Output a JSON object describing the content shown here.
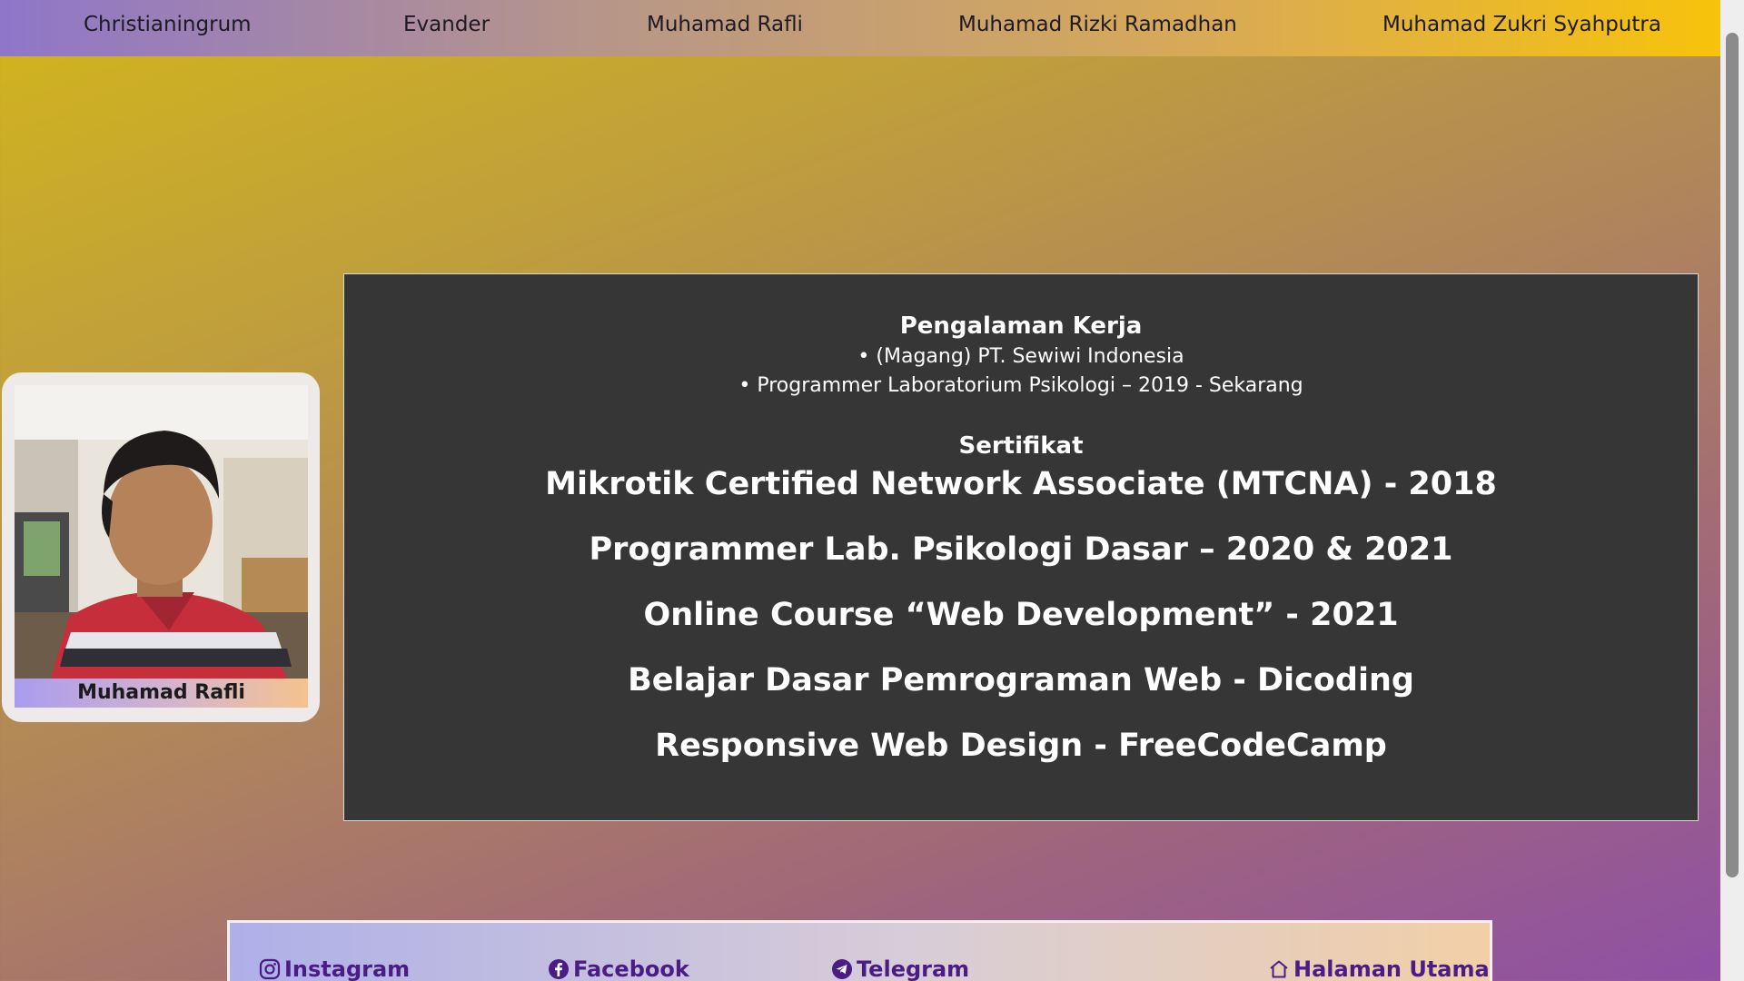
{
  "nav": {
    "items": [
      {
        "label": "Christianingrum"
      },
      {
        "label": "Evander"
      },
      {
        "label": "Muhamad Rafli"
      },
      {
        "label": "Muhamad Rizki Ramadhan"
      },
      {
        "label": "Muhamad Zukri Syahputra"
      }
    ]
  },
  "profile": {
    "name": "Muhamad Rafli",
    "photo_icon": "person-photo"
  },
  "experience": {
    "title": "Pengalaman Kerja",
    "items": [
      "(Magang) PT. Sewiwi Indonesia",
      "Programmer Laboratorium Psikologi – 2019 - Sekarang"
    ]
  },
  "certificates": {
    "title": "Sertifikat",
    "items": [
      "Mikrotik Certified Network Associate (MTCNA) - 2018",
      "Programmer Lab. Psikologi Dasar – 2020 & 2021",
      "Online Course “Web Development” - 2021",
      "Belajar Dasar Pemrograman Web - Dicoding",
      "Responsive Web Design - FreeCodeCamp"
    ]
  },
  "footer": {
    "links": [
      {
        "label": "Instagram",
        "icon": "instagram-icon"
      },
      {
        "label": "Facebook",
        "icon": "facebook-icon"
      },
      {
        "label": "Telegram",
        "icon": "telegram-icon"
      },
      {
        "label": "Halaman Utama",
        "icon": "home-icon"
      }
    ]
  },
  "colors": {
    "panel_bg": "#363636",
    "footer_link": "#4b1c86",
    "nav_gradient_start": "#8f76c9",
    "nav_gradient_end": "#f7c30b"
  }
}
